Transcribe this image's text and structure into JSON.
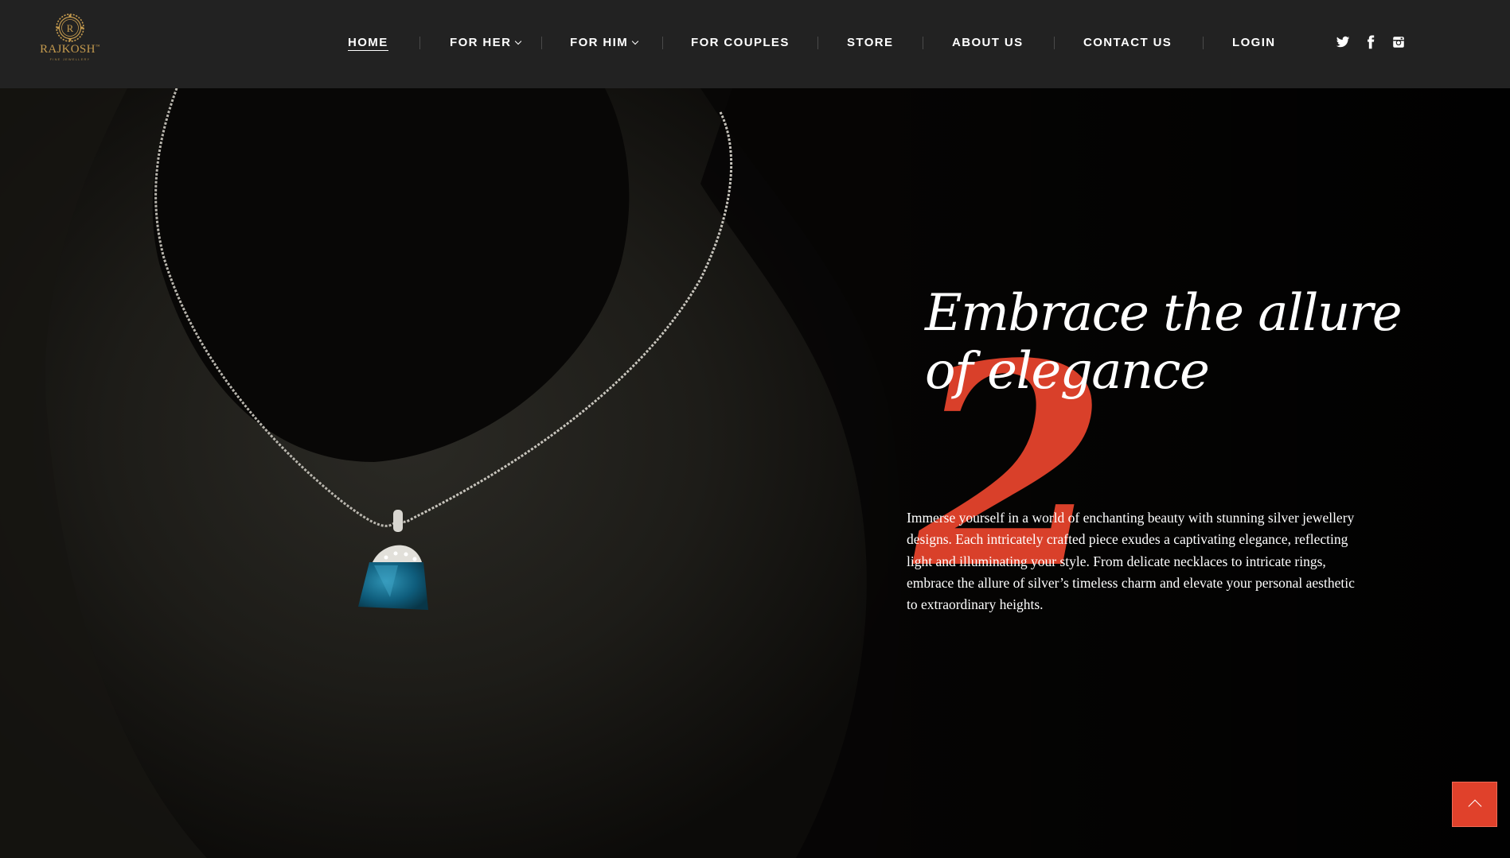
{
  "brand": {
    "logo_letter": "R",
    "name": "RAJKOSH",
    "trademark": "™",
    "tagline": "FINE JEWELLERY"
  },
  "nav": {
    "items": [
      {
        "label": "HOME",
        "active": true,
        "has_dropdown": false
      },
      {
        "label": "FOR HER",
        "active": false,
        "has_dropdown": true
      },
      {
        "label": "FOR HIM",
        "active": false,
        "has_dropdown": true
      },
      {
        "label": "FOR COUPLES",
        "active": false,
        "has_dropdown": false
      },
      {
        "label": "STORE",
        "active": false,
        "has_dropdown": false
      },
      {
        "label": "ABOUT US",
        "active": false,
        "has_dropdown": false
      },
      {
        "label": "CONTACT US",
        "active": false,
        "has_dropdown": false
      },
      {
        "label": "LOGIN",
        "active": false,
        "has_dropdown": false
      }
    ],
    "social": [
      {
        "icon": "twitter-icon"
      },
      {
        "icon": "facebook-icon"
      },
      {
        "icon": "instagram-icon"
      }
    ]
  },
  "hero": {
    "slide_number": "2",
    "title_line1": "Embrace the allure",
    "title_line2": "of elegance",
    "description": "Immerse yourself in a world of enchanting beauty with stunning silver jewellery designs. Each intricately crafted piece exudes a captivating elegance, reflecting light and illuminating your style. From delicate necklaces to intricate rings, embrace the allure of silver’s timeless charm and elevate your personal aesthetic to extraordinary heights."
  },
  "colors": {
    "header_bg": "#222222",
    "accent": "#d9402a",
    "gold": "#c49a4e",
    "text": "#ffffff"
  },
  "scroll_top": {
    "icon": "chevron-up-icon"
  }
}
